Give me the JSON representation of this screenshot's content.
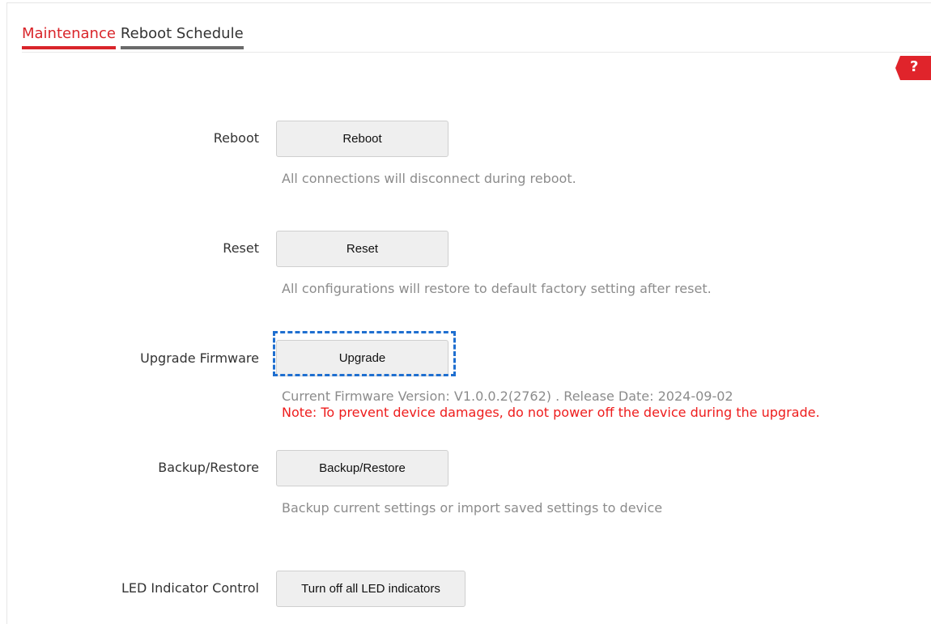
{
  "tabs": [
    {
      "label": "Maintenance",
      "active": true
    },
    {
      "label": "Reboot Schedule",
      "active": false
    }
  ],
  "help": {
    "symbol": "?",
    "icon": "help-icon",
    "color": "#e0242b"
  },
  "sections": {
    "reboot": {
      "label": "Reboot",
      "button": "Reboot",
      "hint": "All connections will disconnect during reboot."
    },
    "reset": {
      "label": "Reset",
      "button": "Reset",
      "hint": "All configurations will restore to default factory setting after reset."
    },
    "upgrade": {
      "label": "Upgrade Firmware",
      "button": "Upgrade",
      "version_line": "Current Firmware Version: V1.0.0.2(2762) . Release Date: 2024-09-02",
      "note": "Note: To prevent device damages, do not power off the device during the upgrade."
    },
    "backup": {
      "label": "Backup/Restore",
      "button": "Backup/Restore",
      "hint": "Backup current settings or import saved settings to device"
    },
    "led": {
      "label": "LED Indicator Control",
      "button": "Turn off all LED indicators"
    }
  },
  "colors": {
    "accent": "#d9252a",
    "note": "#ee1c1c",
    "highlight_box": "#1f6fd0"
  }
}
